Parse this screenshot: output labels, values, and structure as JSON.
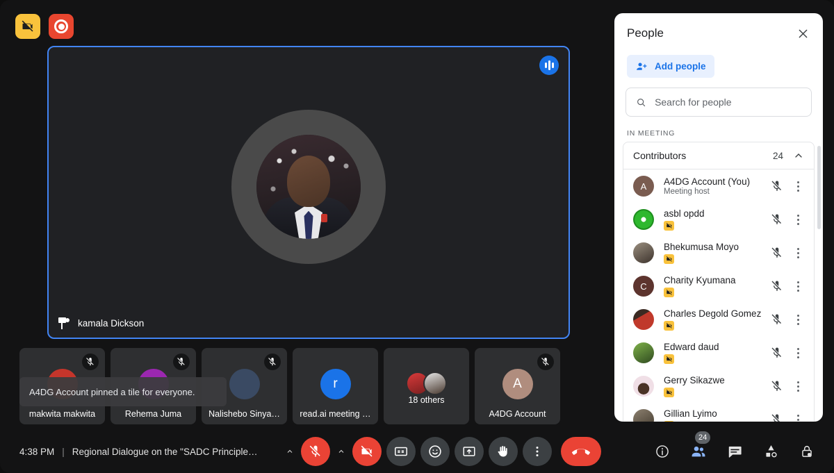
{
  "top_badges": {
    "no_video_icon": "video-off-icon",
    "recording_icon": "recording-icon"
  },
  "stage": {
    "participant_name": "kamala Dickson",
    "pin_icon": "pin-icon",
    "audio_indicator_icon": "audio-level-icon",
    "border_color": "#4285f4"
  },
  "toast": {
    "message": "A4DG Account pinned a tile for everyone."
  },
  "filmstrip": [
    {
      "label": "makwita makwita",
      "avatar_color": "#c5352b",
      "initial": "",
      "muted": true,
      "type": "photo"
    },
    {
      "label": "Rehema Juma",
      "avatar_color": "#9b27b0",
      "initial": "",
      "muted": true,
      "type": "photo"
    },
    {
      "label": "Nalishebo Sinya…",
      "avatar_color": "#3a4a63",
      "initial": "",
      "muted": true,
      "type": "photo"
    },
    {
      "label": "read.ai meeting …",
      "avatar_color": "#1a73e8",
      "initial": "r",
      "muted": false,
      "type": "initial"
    },
    {
      "label": "",
      "avatar_color": "",
      "initial": "",
      "muted": false,
      "type": "others",
      "others_text": "18 others"
    },
    {
      "label": "A4DG Account",
      "avatar_color": "#b08d7e",
      "initial": "A",
      "muted": true,
      "type": "initial"
    }
  ],
  "bottom_bar": {
    "time": "4:38 PM",
    "separator": "|",
    "meeting_title": "Regional Dialogue on the \"SADC Principle…",
    "controls": [
      {
        "name": "mic-expand-chevron",
        "icon": "chevron-up-icon",
        "style": "chevron"
      },
      {
        "name": "mic-button",
        "icon": "mic-off-icon",
        "style": "red",
        "active": true
      },
      {
        "name": "camera-expand-chevron",
        "icon": "chevron-up-icon",
        "style": "chevron"
      },
      {
        "name": "camera-button",
        "icon": "video-off-icon",
        "style": "red",
        "active": true
      },
      {
        "name": "captions-button",
        "icon": "closed-caption-icon",
        "style": "dark"
      },
      {
        "name": "emoji-button",
        "icon": "emoji-icon",
        "style": "dark"
      },
      {
        "name": "present-button",
        "icon": "present-screen-icon",
        "style": "dark"
      },
      {
        "name": "raise-hand-button",
        "icon": "raise-hand-icon",
        "style": "dark"
      },
      {
        "name": "more-options-button",
        "icon": "more-vertical-icon",
        "style": "dark"
      },
      {
        "name": "leave-call-button",
        "icon": "end-call-icon",
        "style": "hangup"
      }
    ],
    "right_controls": [
      {
        "name": "meeting-details-button",
        "icon": "info-icon",
        "active": false
      },
      {
        "name": "people-button",
        "icon": "people-icon",
        "active": true,
        "badge": "24"
      },
      {
        "name": "chat-button",
        "icon": "chat-icon",
        "active": false
      },
      {
        "name": "activities-button",
        "icon": "activities-icon",
        "active": false
      },
      {
        "name": "host-controls-button",
        "icon": "lock-icon",
        "active": false
      }
    ],
    "accent_active": "#8ab4f8",
    "danger": "#ea4335"
  },
  "people_panel": {
    "title": "People",
    "close_icon": "close-icon",
    "add_people_label": "Add people",
    "add_people_icon": "person-add-icon",
    "search_placeholder": "Search for people",
    "search_value": "",
    "search_icon": "search-icon",
    "section_label": "IN MEETING",
    "group": {
      "name": "Contributors",
      "count": "24",
      "collapse_icon": "chevron-up-icon"
    },
    "participants": [
      {
        "name": "A4DG Account (You)",
        "sub": "Meeting host",
        "avatar_color": "#7a5c50",
        "initial": "A",
        "muted": true,
        "flag": false
      },
      {
        "name": "asbl opdd",
        "sub": "",
        "avatar_color": "#2eb82e",
        "initial": "",
        "muted": true,
        "flag": true
      },
      {
        "name": "Bhekumusa Moyo",
        "sub": "",
        "avatar_color": "#6e6a62",
        "initial": "",
        "muted": true,
        "flag": true
      },
      {
        "name": "Charity Kyumana",
        "sub": "",
        "avatar_color": "#5d342e",
        "initial": "C",
        "muted": true,
        "flag": true
      },
      {
        "name": "Charles Degold Gomez",
        "sub": "",
        "avatar_color": "#c0392b",
        "initial": "",
        "muted": true,
        "flag": true
      },
      {
        "name": "Edward daud",
        "sub": "",
        "avatar_color": "#4b7a3a",
        "initial": "",
        "muted": true,
        "flag": true
      },
      {
        "name": "Gerry Sikazwe",
        "sub": "",
        "avatar_color": "#e7d3dd",
        "initial": "",
        "muted": true,
        "flag": true
      },
      {
        "name": "Gillian Lyimo",
        "sub": "",
        "avatar_color": "#6b6354",
        "initial": "",
        "muted": true,
        "flag": true
      }
    ]
  }
}
